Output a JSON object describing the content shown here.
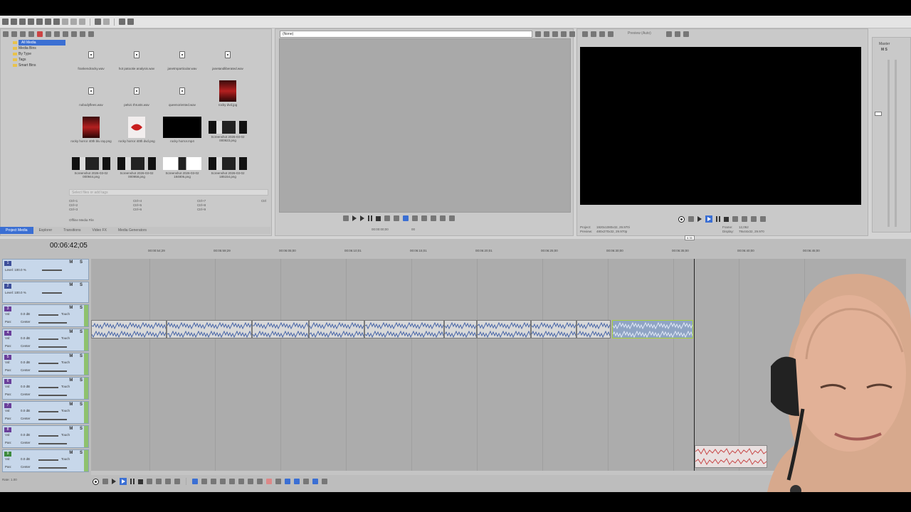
{
  "toolbar": {
    "icons": [
      "new-icon",
      "open-icon",
      "save-icon",
      "properties-icon",
      "render-icon",
      "cut-icon",
      "copy-icon",
      "paste-icon",
      "undo-icon",
      "redo-icon",
      "pointer-icon",
      "help-icon"
    ]
  },
  "project_media": {
    "tree": [
      "All Media",
      "Media Bins",
      "By Type",
      "Tags",
      "Smart Bins"
    ],
    "items": [
      {
        "caption": "frankendracky.wav",
        "kind": "audio"
      },
      {
        "caption": "hot patootie analysis.wav",
        "kind": "audio"
      },
      {
        "caption": "janetmparticular.wav",
        "kind": "audio"
      },
      {
        "caption": "janetandliberated.wav",
        "kind": "audio"
      },
      {
        "caption": "nobodyflees.wav",
        "kind": "audio"
      },
      {
        "caption": "pelvic thrusts.wav",
        "kind": "audio"
      },
      {
        "caption": "queenoriented.wav",
        "kind": "audio"
      },
      {
        "caption": "rocky dvd.jpg",
        "kind": "image-red"
      },
      {
        "caption": "rocky horror 40th blu ray.png",
        "kind": "image-red"
      },
      {
        "caption": "rocky horror 40th dvd.png",
        "kind": "image-lips"
      },
      {
        "caption": "rocky horror.mp4",
        "kind": "video-black"
      },
      {
        "caption": "Screenshot 2026-03-02 000923.png",
        "kind": "screenshot"
      },
      {
        "caption": "Screenshot 2026-03-02 000944.png",
        "kind": "screenshot"
      },
      {
        "caption": "Screenshot 2026-03-02 000958.png",
        "kind": "screenshot"
      },
      {
        "caption": "Screenshot 2026-03-02 184806.png",
        "kind": "screenshot-light"
      },
      {
        "caption": "Screenshot 2026-03-02 185154.png",
        "kind": "screenshot"
      }
    ],
    "search_placeholder": "Select files or add tags",
    "shortcuts": [
      "Ctrl+1",
      "Ctrl+2",
      "Ctrl+3",
      "Ctrl+4",
      "Ctrl+5",
      "Ctrl+6",
      "Ctrl+7",
      "Ctrl+8",
      "Ctrl+9",
      "Ctrl"
    ],
    "offline_label": "Offline Media File",
    "tabs": [
      "Project Media",
      "Explorer",
      "Transitions",
      "Video FX",
      "Media Generators"
    ]
  },
  "trimmer": {
    "source_field": "(None)",
    "time_in": "00:00:00;00",
    "time_small": "00"
  },
  "preview": {
    "label": "Preview (Auto)",
    "info_project_label": "Project:",
    "info_project": "1920x1080x32, 29.970i",
    "info_preview_label": "Preview:",
    "info_preview": "480x270x32, 29.970p",
    "info_frame_label": "Frame:",
    "info_frame": "12,052",
    "info_display_label": "Display:",
    "info_display": "79x44x32, 29.970"
  },
  "master": {
    "label": "Master",
    "ms": "M S"
  },
  "timeline": {
    "timecode": "00:06:42;05",
    "ruler": [
      "00:00:54;29",
      "00:05:59;29",
      "00:06:05;00",
      "00:06:10;01",
      "00:06:15;01",
      "00:06:20;01",
      "00:06:25;00",
      "00:06:30;00",
      "00:06:35;00",
      "00:06:40;00",
      "00:06:45;00"
    ],
    "playhead_label": "6:35",
    "tracks": [
      {
        "num": "1",
        "type": "video",
        "level": "Level: 100.0 %"
      },
      {
        "num": "2",
        "type": "video",
        "level": "Level: 100.0 %"
      },
      {
        "num": "3",
        "type": "audio",
        "vol": "0.0 dB",
        "pan": "Center",
        "mode": "Touch"
      },
      {
        "num": "4",
        "type": "audio",
        "vol": "0.0 dB",
        "pan": "Center",
        "mode": "Touch"
      },
      {
        "num": "5",
        "type": "audio",
        "vol": "0.0 dB",
        "pan": "Center",
        "mode": "Touch"
      },
      {
        "num": "6",
        "type": "audio",
        "vol": "0.0 dB",
        "pan": "Center",
        "mode": "Touch"
      },
      {
        "num": "7",
        "type": "audio",
        "vol": "0.0 dB",
        "pan": "Center",
        "mode": "Touch"
      },
      {
        "num": "8",
        "type": "audio",
        "vol": "0.0 dB",
        "pan": "Center",
        "mode": "Touch"
      },
      {
        "num": "9",
        "type": "audio-rec",
        "vol": "0.0 dB",
        "pan": "Center",
        "mode": "Touch"
      }
    ],
    "vol_label": "Vol:",
    "pan_label": "Pan:",
    "rate": "Rate: 1.00"
  },
  "colors": {
    "selection": "#3b6fd3",
    "track_header": "#c7d7ea",
    "audio_wave": "#4a67a8",
    "clip_selected_border": "#a7d13a",
    "record_strip": "#8fc16e"
  }
}
